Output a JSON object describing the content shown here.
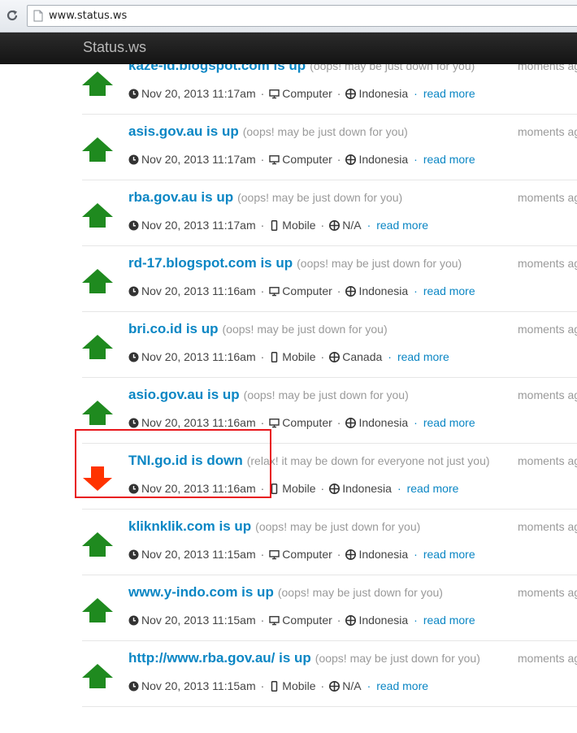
{
  "browser": {
    "url": "www.status.ws"
  },
  "navbar": {
    "brand": "Status.ws"
  },
  "items": [
    {
      "title": "kaze-id.blogspot.com is up",
      "note": "(oops! may be just down for you)",
      "status": "up",
      "timestamp": "Nov 20, 2013 11:17am",
      "device": "Computer",
      "device_icon": "computer-icon",
      "location": "Indonesia",
      "read_more": "read more",
      "ago": "moments ago"
    },
    {
      "title": "asis.gov.au is up",
      "note": "(oops! may be just down for you)",
      "status": "up",
      "timestamp": "Nov 20, 2013 11:17am",
      "device": "Computer",
      "device_icon": "computer-icon",
      "location": "Indonesia",
      "read_more": "read more",
      "ago": "moments ago"
    },
    {
      "title": "rba.gov.au is up",
      "note": "(oops! may be just down for you)",
      "status": "up",
      "timestamp": "Nov 20, 2013 11:17am",
      "device": "Mobile",
      "device_icon": "mobile-icon",
      "location": "N/A",
      "read_more": "read more",
      "ago": "moments ago"
    },
    {
      "title": "rd-17.blogspot.com is up",
      "note": "(oops! may be just down for you)",
      "status": "up",
      "timestamp": "Nov 20, 2013 11:16am",
      "device": "Computer",
      "device_icon": "computer-icon",
      "location": "Indonesia",
      "read_more": "read more",
      "ago": "moments ago"
    },
    {
      "title": "bri.co.id is up",
      "note": "(oops! may be just down for you)",
      "status": "up",
      "timestamp": "Nov 20, 2013 11:16am",
      "device": "Mobile",
      "device_icon": "mobile-icon",
      "location": "Canada",
      "read_more": "read more",
      "ago": "moments ago"
    },
    {
      "title": "asio.gov.au is up",
      "note": "(oops! may be just down for you)",
      "status": "up",
      "timestamp": "Nov 20, 2013 11:16am",
      "device": "Computer",
      "device_icon": "computer-icon",
      "location": "Indonesia",
      "read_more": "read more",
      "ago": "moments ago"
    },
    {
      "title": "TNI.go.id is down",
      "note": "(relax! it may be down for everyone not just you)",
      "status": "down",
      "timestamp": "Nov 20, 2013 11:16am",
      "device": "Mobile",
      "device_icon": "mobile-icon",
      "location": "Indonesia",
      "read_more": "read more",
      "ago": "moments ago"
    },
    {
      "title": "kliknklik.com is up",
      "note": "(oops! may be just down for you)",
      "status": "up",
      "timestamp": "Nov 20, 2013 11:15am",
      "device": "Computer",
      "device_icon": "computer-icon",
      "location": "Indonesia",
      "read_more": "read more",
      "ago": "moments ago"
    },
    {
      "title": "www.y-indo.com is up",
      "note": "(oops! may be just down for you)",
      "status": "up",
      "timestamp": "Nov 20, 2013 11:15am",
      "device": "Computer",
      "device_icon": "computer-icon",
      "location": "Indonesia",
      "read_more": "read more",
      "ago": "moments ago"
    },
    {
      "title": "http://www.rba.gov.au/ is up",
      "note": "(oops! may be just down for you)",
      "status": "up",
      "timestamp": "Nov 20, 2013 11:15am",
      "device": "Mobile",
      "device_icon": "mobile-icon",
      "location": "N/A",
      "read_more": "read more",
      "ago": "moments ago"
    }
  ],
  "colors": {
    "up_arrow": "#1f8a1f",
    "down_arrow": "#ff3300",
    "link": "#0a86c4",
    "highlight": "#e8161b"
  }
}
